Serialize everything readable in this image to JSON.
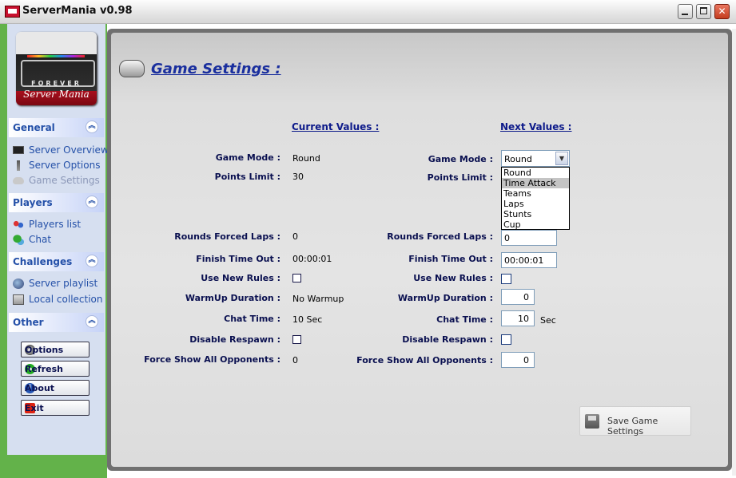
{
  "window": {
    "title": "ServerMania v0.98",
    "minimize": "_",
    "maximize": "□",
    "close": "✕"
  },
  "logo": {
    "line1": "FOREVER",
    "line2": "Server Mania"
  },
  "sidebar": {
    "groups": [
      {
        "title": "General",
        "items": [
          {
            "label": "Server Overview",
            "icon": "monitor-icon"
          },
          {
            "label": "Server Options",
            "icon": "tool-icon"
          },
          {
            "label": "Game Settings",
            "icon": "controller-icon",
            "disabled": true
          }
        ]
      },
      {
        "title": "Players",
        "items": [
          {
            "label": "Players list",
            "icon": "people-icon"
          },
          {
            "label": "Chat",
            "icon": "chat-icon"
          }
        ]
      },
      {
        "title": "Challenges",
        "items": [
          {
            "label": "Server playlist",
            "icon": "globe-icon"
          },
          {
            "label": "Local collection",
            "icon": "box-icon"
          }
        ]
      },
      {
        "title": "Other",
        "buttons": [
          {
            "label": "Options",
            "icon": "gear-icon"
          },
          {
            "label": "Refresh",
            "icon": "refresh-icon"
          },
          {
            "label": "About",
            "icon": "info-icon"
          },
          {
            "label": "Exit",
            "icon": "exit-icon"
          }
        ]
      }
    ]
  },
  "page": {
    "title": "Game Settings :",
    "current_header": "Current Values :",
    "next_header": "Next Values :"
  },
  "settings": {
    "game_mode": {
      "label": "Game Mode :",
      "current": "Round",
      "next": "Round"
    },
    "points_limit": {
      "label": "Points Limit :",
      "current": "30"
    },
    "rounds_forced_laps": {
      "label": "Rounds Forced Laps :",
      "current": "0",
      "next": "0"
    },
    "finish_time_out": {
      "label": "Finish Time Out :",
      "current": "00:00:01",
      "next": "00:00:01"
    },
    "use_new_rules": {
      "label": "Use New Rules :",
      "current": false,
      "next": false
    },
    "warmup_duration": {
      "label": "WarmUp Duration :",
      "current": "No Warmup",
      "next": "0"
    },
    "chat_time": {
      "label": "Chat Time :",
      "current": "10 Sec",
      "next": "10",
      "unit": "Sec"
    },
    "disable_respawn": {
      "label": "Disable Respawn :",
      "current": false,
      "next": false
    },
    "force_show_all_opponents": {
      "label": "Force Show All Opponents :",
      "current": "0",
      "next": "0"
    }
  },
  "game_mode_options": [
    "Round",
    "Time Attack",
    "Teams",
    "Laps",
    "Stunts",
    "Cup"
  ],
  "game_mode_highlighted": "Time Attack",
  "save_button": {
    "label": "Save Game Settings"
  },
  "colors": {
    "sidebar_green": "#63b24a",
    "link_blue": "#2450a8",
    "title_blue": "#1a2f9e",
    "panel_grey": "#e0e0e0"
  }
}
